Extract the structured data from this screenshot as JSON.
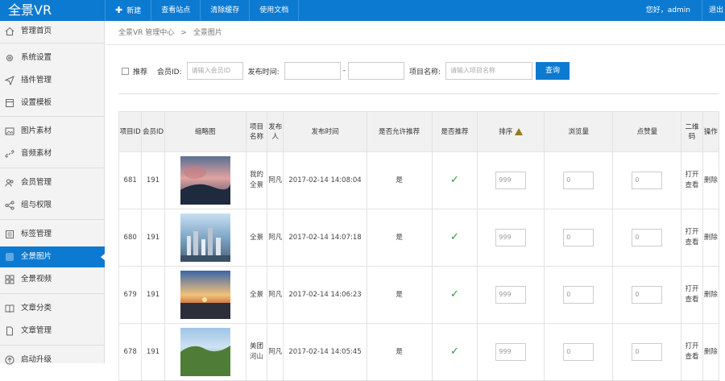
{
  "brand": "全景VR",
  "topnav": [
    {
      "label": "新建",
      "plus": "✚"
    },
    {
      "label": "查看站点"
    },
    {
      "label": "清除缓存"
    },
    {
      "label": "使用文档"
    }
  ],
  "greeting": "您好，admin",
  "logout": "退出",
  "sidebar": {
    "items": [
      {
        "label": "管理首页",
        "icon": "home-icon"
      },
      {
        "label": "系统设置",
        "icon": "gear-icon"
      },
      {
        "label": "插件管理",
        "icon": "paper-plane-icon"
      },
      {
        "label": "设置模板",
        "icon": "template-icon"
      },
      {
        "label": "图片素材",
        "icon": "image-icon"
      },
      {
        "label": "音频素材",
        "icon": "link-icon"
      },
      {
        "label": "会员管理",
        "icon": "users-icon"
      },
      {
        "label": "组与权限",
        "icon": "share-icon"
      },
      {
        "label": "标签管理",
        "icon": "tag-list-icon"
      },
      {
        "label": "全景图片",
        "icon": "panorama-image-icon",
        "active": true
      },
      {
        "label": "全景视频",
        "icon": "grid-icon"
      },
      {
        "label": "文章分类",
        "icon": "book-icon"
      },
      {
        "label": "文章管理",
        "icon": "document-icon"
      },
      {
        "label": "启动升级",
        "icon": "upgrade-icon"
      }
    ]
  },
  "breadcrumb": {
    "root": "全景VR 管理中心",
    "sep": ">",
    "current": "全景图片"
  },
  "filter": {
    "recommend_label": "推荐",
    "member_label": "会员ID:",
    "member_placeholder": "请输入会员ID",
    "time_label": "发布时间:",
    "dash": "-",
    "name_label": "项目名称:",
    "name_placeholder": "请输入项目名称",
    "query_button": "查询"
  },
  "table": {
    "headers": {
      "pid": "项目ID",
      "uid": "会员ID",
      "thumb": "缩略图",
      "name": "项目名称",
      "publisher": "发布人",
      "time": "发布时间",
      "allow": "是否允许推荐",
      "recommended": "是否推荐",
      "sort": "排序",
      "views": "浏览量",
      "likes": "点赞量",
      "qrcode": "二维码",
      "ops": "操作"
    },
    "rows": [
      {
        "pid": "681",
        "uid": "191",
        "name": "我的全景",
        "publisher": "阿凡",
        "time": "2017-02-14 14:08:04",
        "allow": "是",
        "rec": "✓",
        "sort": "999",
        "views": "0",
        "likes": "0",
        "qr": "打开查看",
        "op": "删除"
      },
      {
        "pid": "680",
        "uid": "191",
        "name": "全景",
        "publisher": "阿凡",
        "time": "2017-02-14 14:07:18",
        "allow": "是",
        "rec": "✓",
        "sort": "999",
        "views": "0",
        "likes": "0",
        "qr": "打开查看",
        "op": "删除"
      },
      {
        "pid": "679",
        "uid": "191",
        "name": "全景",
        "publisher": "阿凡",
        "time": "2017-02-14 14:06:23",
        "allow": "是",
        "rec": "✓",
        "sort": "999",
        "views": "0",
        "likes": "0",
        "qr": "打开查看",
        "op": "删除"
      },
      {
        "pid": "678",
        "uid": "191",
        "name": "美团河山",
        "publisher": "阿凡",
        "time": "2017-02-14 14:05:45",
        "allow": "是",
        "rec": "✓",
        "sort": "999",
        "views": "0",
        "likes": "0",
        "qr": "打开查看",
        "op": "删除"
      }
    ]
  },
  "colors": {
    "primary": "#0d7ad1",
    "check": "#2a9a3a"
  }
}
